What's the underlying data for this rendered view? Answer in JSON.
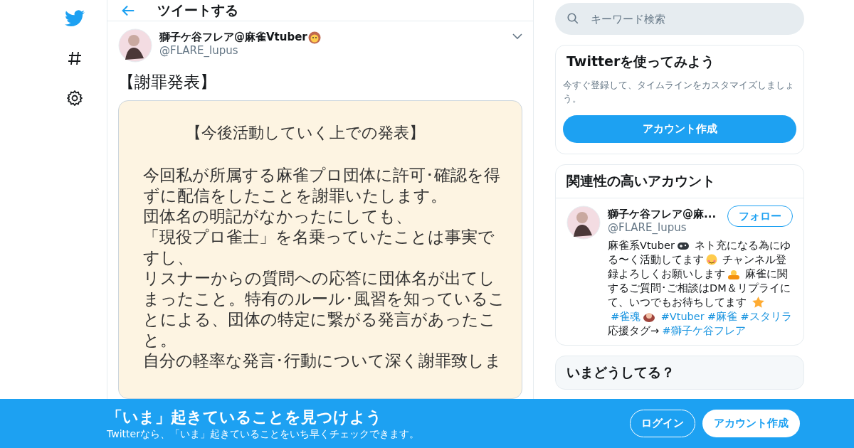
{
  "nav": {
    "items": [
      {
        "kind": "logo"
      },
      {
        "kind": "hashtag"
      },
      {
        "kind": "settings"
      }
    ]
  },
  "header": {
    "title": "ツイートする"
  },
  "tweet": {
    "author": {
      "name": "獅子ケ谷フレア@麻雀Vtuber",
      "handle": "@FLARE_lupus"
    },
    "text": "【謝罪発表】",
    "image": {
      "heading": "【今後活動していく上での発表】",
      "lines": [
        "今回私が所属する麻雀プロ団体に許可･確認を得",
        "ずに配信をしたことを謝罪いたします。",
        "団体名の明記がなかったにしても、",
        "「現役プロ雀士」を名乗っていたことは事実で",
        "すし、",
        "リスナーからの質問への応答に団体名が出てし",
        "まったこと。特有のルール･風習を知っているこ",
        "とによる、団体の特定に繋がる発言があったこ",
        "と。",
        "自分の軽率な発言･行動について深く謝罪致しま"
      ]
    }
  },
  "search": {
    "placeholder": "キーワード検索"
  },
  "signup_card": {
    "title": "Twitterを使ってみよう",
    "text": "今すぐ登録して、タイムラインをカスタマイズしましょう。",
    "button": "アカウント作成"
  },
  "related": {
    "title": "関連性の高いアカウント",
    "accounts": [
      {
        "name": "獅子ケ谷フレア@麻...",
        "handle": "@FLARE_lupus",
        "follow": "フォロー",
        "bio": [
          {
            "kind": "text",
            "text": "麻雀系Vtuber"
          },
          {
            "kind": "gamepad"
          },
          {
            "kind": "text",
            "text": " ネト充になる為にゆる〜く活動してます"
          },
          {
            "kind": "smile"
          },
          {
            "kind": "text",
            "text": " チャンネル登録よろしくお願いします"
          },
          {
            "kind": "bow"
          },
          {
            "kind": "text",
            "text": " 麻雀に関するご質問･ご相談はDM＆リプライにて、いつでもお待ちしてます "
          },
          {
            "kind": "star"
          },
          {
            "kind": "tag",
            "text": "#雀魂"
          },
          {
            "kind": "creature"
          },
          {
            "kind": "tag",
            "text": "#Vtuber"
          },
          {
            "kind": "tag",
            "text": "#麻雀"
          },
          {
            "kind": "tag",
            "text": "#スタリラ"
          },
          {
            "kind": "text",
            "text": " 応援タグ→"
          },
          {
            "kind": "tag",
            "text": "#獅子ケ谷フレア"
          }
        ]
      }
    ]
  },
  "trends": {
    "title": "いまどうしてる？"
  },
  "banner": {
    "title": "「いま」起きていることを見つけよう",
    "subtitle": "Twitterなら、「いま」起きていることをいち早くチェックできます。",
    "login": "ログイン",
    "signup": "アカウント作成"
  }
}
